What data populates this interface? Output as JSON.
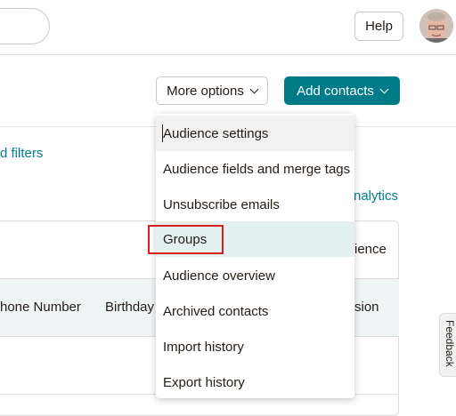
{
  "header": {
    "help_label": "Help"
  },
  "actions": {
    "more_options_label": "More options",
    "add_contacts_label": "Add contacts"
  },
  "links": {
    "filters_partial": "d filters",
    "analytics_partial": "nalytics"
  },
  "table": {
    "audience_partial": "ience",
    "columns": [
      "hone Number",
      "Birthday",
      "sion"
    ]
  },
  "dropdown": {
    "items": [
      {
        "label": "Audience settings"
      },
      {
        "label": "Audience fields and merge tags"
      },
      {
        "label": "Unsubscribe emails"
      },
      {
        "label": "Groups"
      },
      {
        "label": "Audience overview"
      },
      {
        "label": "Archived contacts"
      },
      {
        "label": "Import history"
      },
      {
        "label": "Export history"
      }
    ],
    "highlighted_item": "Groups"
  },
  "feedback": {
    "label": "Feedback"
  },
  "colors": {
    "accent": "#007c89",
    "highlight_box": "#d61f1f",
    "row_highlight": "#e3f1f1"
  },
  "icons": [
    "search-input",
    "chevron-down-icon",
    "avatar-image"
  ]
}
